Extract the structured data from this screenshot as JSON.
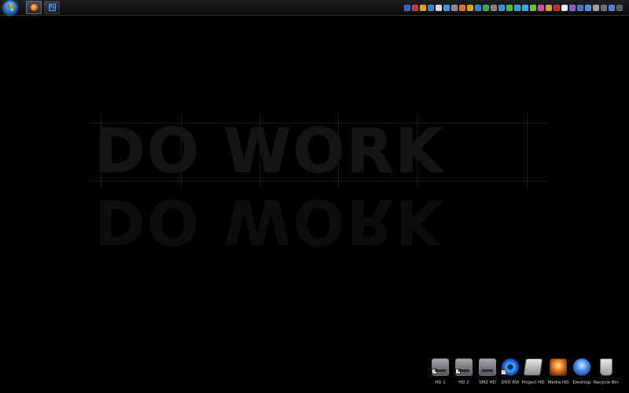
{
  "wallpaper": {
    "headline": "DO WORK"
  },
  "taskbar": {
    "start_icon": "windows-orb-icon",
    "buttons": [
      {
        "icon": "firefox-icon",
        "active": true
      },
      {
        "icon": "photoshop-icon",
        "active": false,
        "glyph": "Ps"
      }
    ],
    "tray_icons": [
      {
        "name": "app-icon",
        "color": "#2a63c9"
      },
      {
        "name": "app-icon",
        "color": "#c23b22"
      },
      {
        "name": "app-icon",
        "color": "#e0a020"
      },
      {
        "name": "app-icon",
        "color": "#2f7fd0"
      },
      {
        "name": "app-icon",
        "color": "#d9d9d9"
      },
      {
        "name": "app-icon",
        "color": "#3a8ee6"
      },
      {
        "name": "app-icon",
        "color": "#8a8a8a"
      },
      {
        "name": "app-icon",
        "color": "#e96b1a"
      },
      {
        "name": "app-icon",
        "color": "#d8a21c"
      },
      {
        "name": "app-icon",
        "color": "#2f7fd0"
      },
      {
        "name": "app-icon",
        "color": "#39a64b"
      },
      {
        "name": "app-icon",
        "color": "#7f7f7f"
      },
      {
        "name": "app-icon",
        "color": "#3d8ad9"
      },
      {
        "name": "app-icon",
        "color": "#45b345"
      },
      {
        "name": "app-icon",
        "color": "#2e9fd6"
      },
      {
        "name": "app-icon",
        "color": "#2ba9e1"
      },
      {
        "name": "app-icon",
        "color": "#6ebf2c"
      },
      {
        "name": "app-icon",
        "color": "#d04a9a"
      },
      {
        "name": "app-icon",
        "color": "#d4a020"
      },
      {
        "name": "app-icon",
        "color": "#c82a2a"
      },
      {
        "name": "app-icon",
        "color": "#f0f0f0"
      },
      {
        "name": "app-icon",
        "color": "#7b5cc4"
      },
      {
        "name": "app-icon",
        "color": "#3e73c8"
      },
      {
        "name": "app-icon",
        "color": "#4a8be0"
      },
      {
        "name": "app-icon",
        "color": "#a0a0a0"
      },
      {
        "name": "app-icon",
        "color": "#6a6a6a"
      },
      {
        "name": "app-icon",
        "color": "#4b7fd1"
      },
      {
        "name": "app-icon",
        "color": "#5a5a5a"
      }
    ]
  },
  "dock": {
    "items": [
      {
        "label": "HD 1",
        "icon": "hard-drive-icon",
        "kind": "drive"
      },
      {
        "label": "HD 2",
        "icon": "hard-drive-icon",
        "kind": "drive"
      },
      {
        "label": "SM2 HD",
        "icon": "hard-drive-icon",
        "kind": "drive"
      },
      {
        "label": "DVD RW",
        "icon": "dvd-drive-icon",
        "kind": "dvd"
      },
      {
        "label": "Project HD",
        "icon": "project-drive-icon",
        "kind": "project"
      },
      {
        "label": "Media HD",
        "icon": "media-drive-icon",
        "kind": "media"
      },
      {
        "label": "Desktop",
        "icon": "desktop-globe-icon",
        "kind": "desktop"
      },
      {
        "label": "Recycle Bin",
        "icon": "recycle-bin-icon",
        "kind": "bin"
      }
    ]
  }
}
